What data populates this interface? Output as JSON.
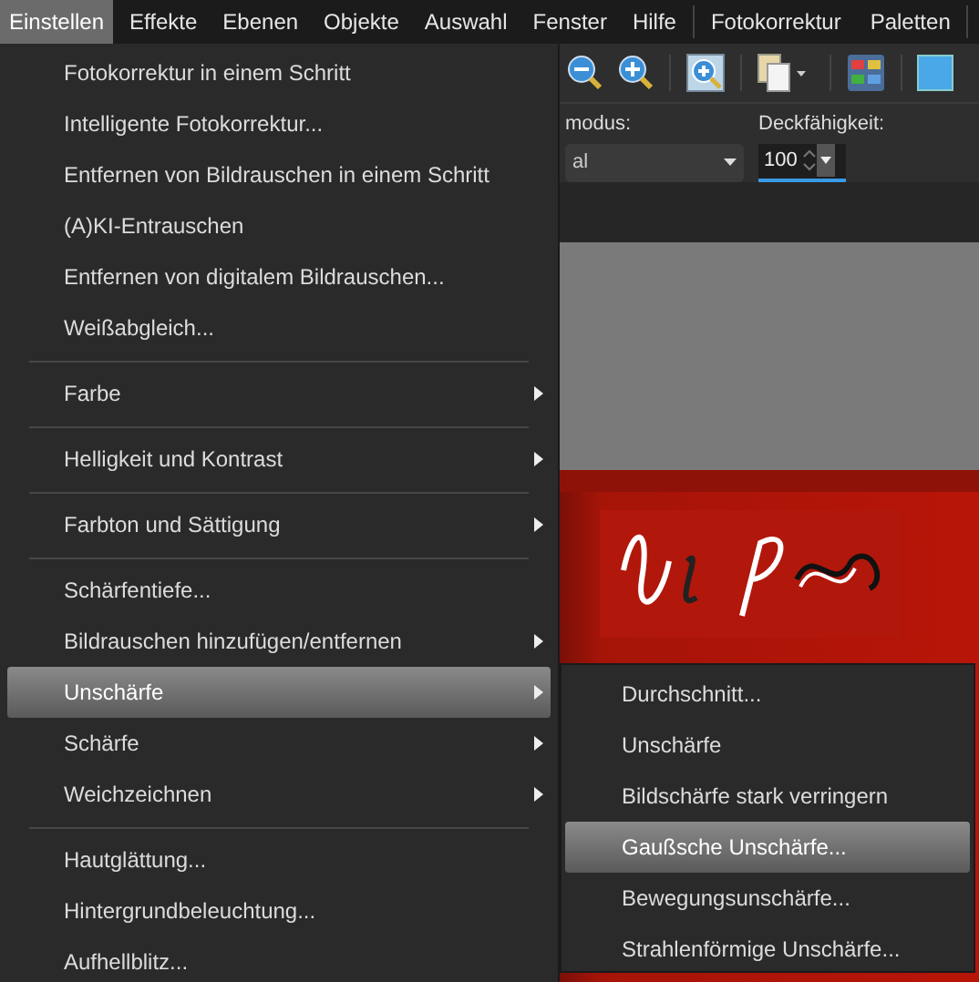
{
  "menus": [
    {
      "label": "Einstellen",
      "selected": true
    },
    {
      "label": "Effekte",
      "selected": false
    },
    {
      "label": "Ebenen",
      "selected": false
    },
    {
      "label": "Objekte",
      "selected": false
    },
    {
      "label": "Auswahl",
      "selected": false
    },
    {
      "label": "Fenster",
      "selected": false
    },
    {
      "label": "Hilfe",
      "selected": false
    }
  ],
  "workspace_menus": [
    {
      "label": "Fotokorrektur",
      "selected": false
    },
    {
      "label": "Paletten",
      "selected": false
    }
  ],
  "property_bar": {
    "mode_label": "modus:",
    "mode_value": "al",
    "opacity_label": "Deckfähigkeit:",
    "opacity_value": "100"
  },
  "menu": [
    {
      "kind": "item",
      "label": "Fotokorrektur in einem Schritt",
      "submenu": false,
      "selected": false
    },
    {
      "kind": "item",
      "label": "Intelligente Fotokorrektur...",
      "submenu": false,
      "selected": false
    },
    {
      "kind": "item",
      "label": "Entfernen von Bildrauschen in einem Schritt",
      "submenu": false,
      "selected": false
    },
    {
      "kind": "item",
      "label": "(A)KI-Entrauschen",
      "submenu": false,
      "selected": false
    },
    {
      "kind": "item",
      "label": "Entfernen von digitalem Bildrauschen...",
      "submenu": false,
      "selected": false
    },
    {
      "kind": "item",
      "label": "Weißabgleich...",
      "submenu": false,
      "selected": false
    },
    {
      "kind": "separator"
    },
    {
      "kind": "item",
      "label": "Farbe",
      "submenu": true,
      "selected": false
    },
    {
      "kind": "separator"
    },
    {
      "kind": "item",
      "label": "Helligkeit und Kontrast",
      "submenu": true,
      "selected": false
    },
    {
      "kind": "separator"
    },
    {
      "kind": "item",
      "label": "Farbton und Sättigung",
      "submenu": true,
      "selected": false
    },
    {
      "kind": "separator"
    },
    {
      "kind": "item",
      "label": "Schärfentiefe...",
      "submenu": false,
      "selected": false
    },
    {
      "kind": "item",
      "label": "Bildrauschen hinzufügen/entfernen",
      "submenu": true,
      "selected": false
    },
    {
      "kind": "item",
      "label": "Unschärfe",
      "submenu": true,
      "selected": true
    },
    {
      "kind": "item",
      "label": "Schärfe",
      "submenu": true,
      "selected": false
    },
    {
      "kind": "item",
      "label": "Weichzeichnen",
      "submenu": true,
      "selected": false
    },
    {
      "kind": "separator"
    },
    {
      "kind": "item",
      "label": "Hautglättung...",
      "submenu": false,
      "selected": false
    },
    {
      "kind": "item",
      "label": "Hintergrundbeleuchtung...",
      "submenu": false,
      "selected": false
    },
    {
      "kind": "item",
      "label": "Aufhellblitz...",
      "submenu": false,
      "selected": false
    }
  ],
  "submenu": [
    {
      "label": "Durchschnitt...",
      "selected": false
    },
    {
      "label": "Unschärfe",
      "selected": false
    },
    {
      "label": "Bildschärfe stark verringern",
      "selected": false
    },
    {
      "label": "Gaußsche Unschärfe...",
      "selected": true
    },
    {
      "label": "Bewegungsunschärfe...",
      "selected": false
    },
    {
      "label": "Strahlenförmige Unschärfe...",
      "selected": false
    }
  ]
}
